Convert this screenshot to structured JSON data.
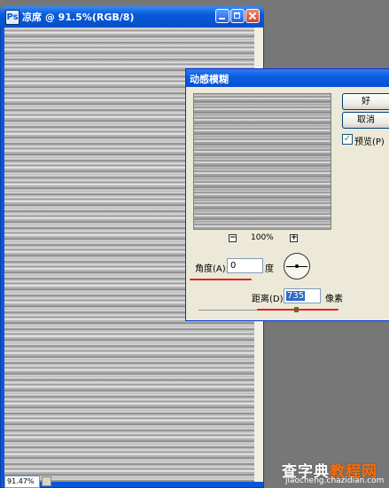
{
  "document": {
    "title": "凉席 @ 91.5%(RGB/8)",
    "zoom_status": "91.47%"
  },
  "dialog": {
    "title": "动感模糊",
    "ok_label": "好",
    "cancel_label": "取消",
    "preview_label": "预览(P)",
    "preview_checked": true,
    "zoom_level": "100%",
    "zoom_minus": "−",
    "zoom_plus": "+",
    "angle_label": "角度(A):",
    "angle_value": "0",
    "angle_unit": "度",
    "distance_label": "距离(D):",
    "distance_value": "735",
    "distance_unit": "像素"
  },
  "watermark": {
    "main": "查字典",
    "secondary": "教程网",
    "url": "jiaocheng.chazidian.com"
  },
  "colors": {
    "titlebar": "#0a5be0",
    "dialog_bg": "#ece9d8",
    "annotation": "#e8201c",
    "selection": "#316ac5"
  },
  "icons": {
    "app": "photoshop-doc-icon",
    "minimize": "minimize-icon",
    "maximize": "maximize-icon",
    "close": "close-icon",
    "check": "checkmark-icon",
    "angle_dial": "angle-dial-icon"
  }
}
